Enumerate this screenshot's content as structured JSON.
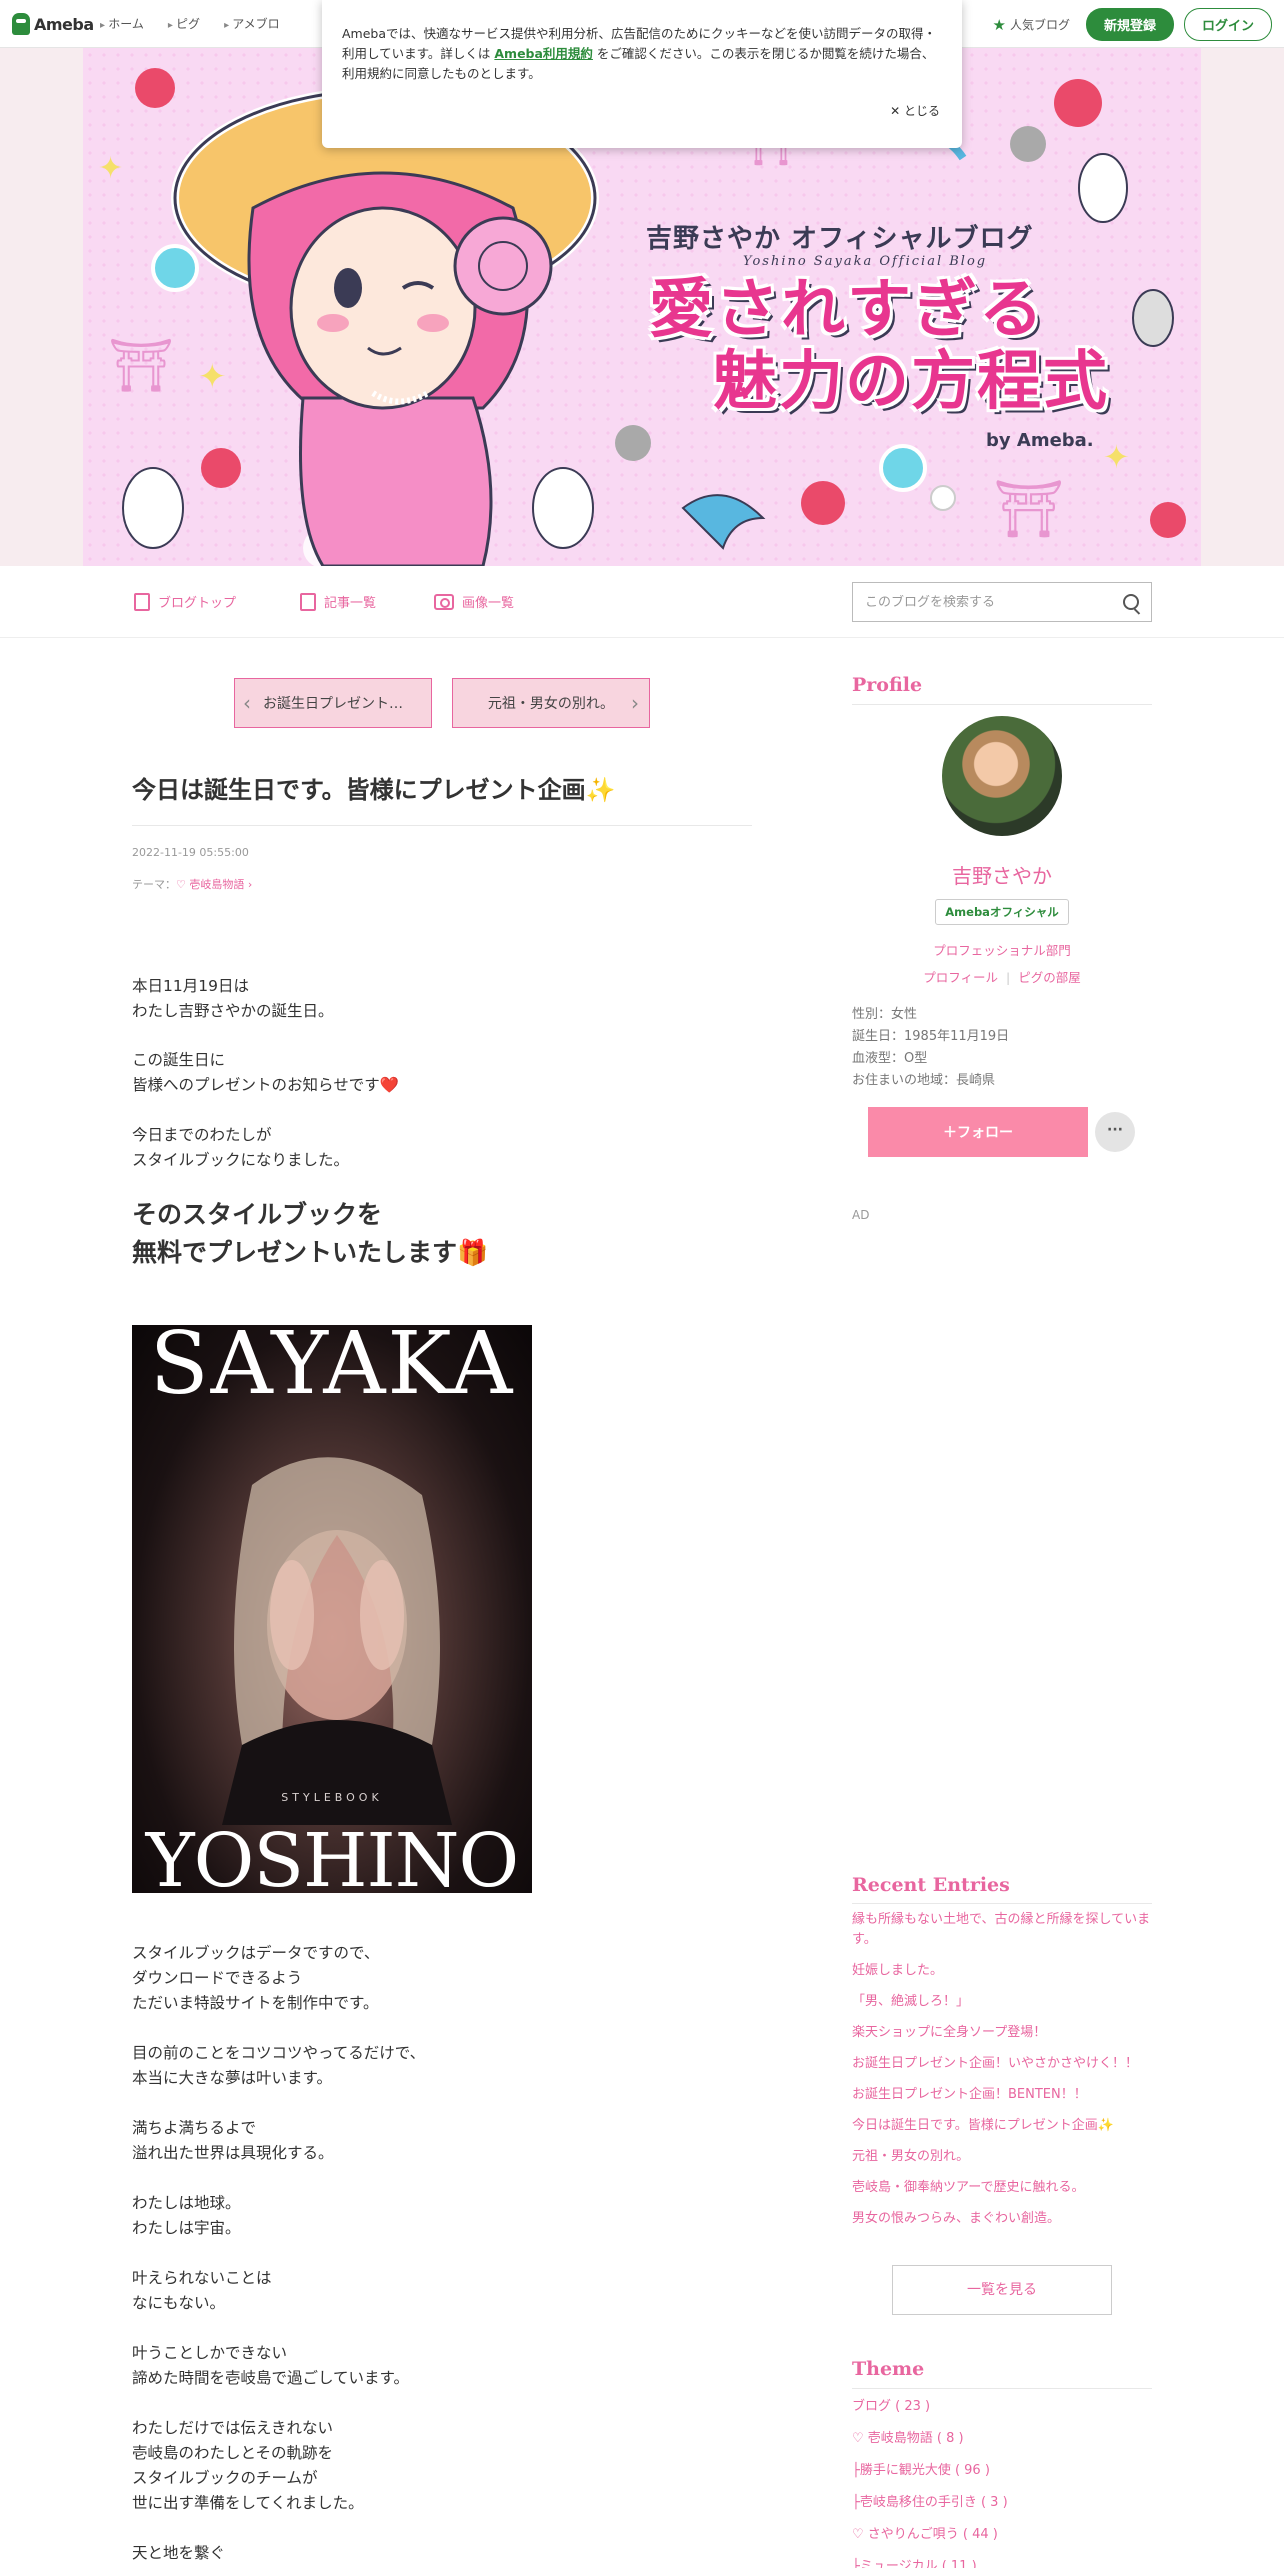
{
  "topbar": {
    "logo": "Ameba",
    "nav": [
      "ホーム",
      "ピグ",
      "アメブロ"
    ],
    "popular": "人気ブログ",
    "register": "新規登録",
    "login": "ログイン"
  },
  "cookie": {
    "text1": "Amebaでは、快適なサービス提供や利用分析、広告配信のためにクッキーなどを使い訪問データの取得・利用しています。詳しくは",
    "link": "Ameba利用規約",
    "text2": "をご確認ください。この表示を閉じるか閲覧を続けた場合、利用規約に同意したものとします。",
    "close": "✕ とじる"
  },
  "banner": {
    "title1": "吉野さやか オフィシャルブログ",
    "subtitle": "Yoshino Sayaka Official Blog",
    "title2a": "愛されすぎる",
    "title2b": "魅力の方程式",
    "by": "by Ameba."
  },
  "blognav": {
    "top": "ブログトップ",
    "list": "記事一覧",
    "images": "画像一覧",
    "search_placeholder": "このブログを検索する"
  },
  "pager": {
    "prev": "お誕生日プレゼント…",
    "next": "元祖・男女の別れ。"
  },
  "entry": {
    "title": "今日は誕生日です。皆様にプレゼント企画✨",
    "date": "2022-11-19 05:55:00",
    "theme_label": "テーマ：",
    "theme": "♡ 壱岐島物語",
    "p1": "本日11月19日は\nわたし吉野さやかの誕生日。",
    "p2": "この誕生日に\n皆様へのプレゼントのお知らせです❤️",
    "p3": "今日までのわたしが\nスタイルブックになりました。",
    "big": "そのスタイルブックを\n無料でプレゼントいたします🎁",
    "stylebook_top": "SAYAKA",
    "stylebook_label": "STYLEBOOK",
    "stylebook_bottom": "YOSHINO",
    "p4": "スタイルブックはデータですので、\nダウンロードできるよう\nただいま特設サイトを制作中です。",
    "p5": "目の前のことをコツコツやってるだけで、\n本当に大きな夢は叶います。",
    "p6": "満ちよ満ちるよで\n溢れ出た世界は具現化する。",
    "p7": "わたしは地球。\nわたしは宇宙。",
    "p8": "叶えられないことは\nなにもない。",
    "p9": "叶うことしかできない\n諦めた時間を壱岐島で過ごしています。",
    "p10": "わたしだけでは伝えきれない\n壱岐島のわたしとその軌跡を\nスタイルブックのチームが\n世に出す準備をしてくれました。",
    "p11": "天と地を繋ぐ"
  },
  "profile": {
    "heading": "Profile",
    "name": "吉野さやか",
    "badge": "Amebaオフィシャル",
    "category": "プロフェッショナル部門",
    "link_profile": "プロフィール",
    "link_pig": "ピグの部屋",
    "gender": "性別：女性",
    "birthday": "誕生日：1985年11月19日",
    "blood": "血液型：O型",
    "area": "お住まいの地域：長崎県",
    "follow": "＋フォロー",
    "more": "···"
  },
  "ad": "AD",
  "recent": {
    "heading": "Recent Entries",
    "items": [
      "縁も所縁もない土地で、古の縁と所縁を探しています。",
      "妊娠しました。",
      "「男、絶滅しろ！」",
      "楽天ショップに全身ソープ登場！",
      "お誕生日プレゼント企画！いやさかさやけく！！",
      "お誕生日プレゼント企画！BENTEN！！",
      "今日は誕生日です。皆様にプレゼント企画✨",
      "元祖・男女の別れ。",
      "壱岐島・御奉納ツアーで歴史に触れる。",
      "男女の恨みつらみ、まぐわい創造。"
    ],
    "see_all": "一覧を見る"
  },
  "theme": {
    "heading": "Theme",
    "items": [
      "ブログ ( 23 )",
      "♡ 壱岐島物語 ( 8 )",
      "├勝手に観光大使 ( 96 )",
      "├壱岐島移住の手引き ( 3 )",
      "♡ さやりんご唄う ( 44 )",
      "├ミュージカル ( 11 )"
    ]
  },
  "colors": {
    "brand_green": "#2d8c3c",
    "accent_pink": "#e8669f",
    "follow_pink": "#fa8aa9"
  }
}
